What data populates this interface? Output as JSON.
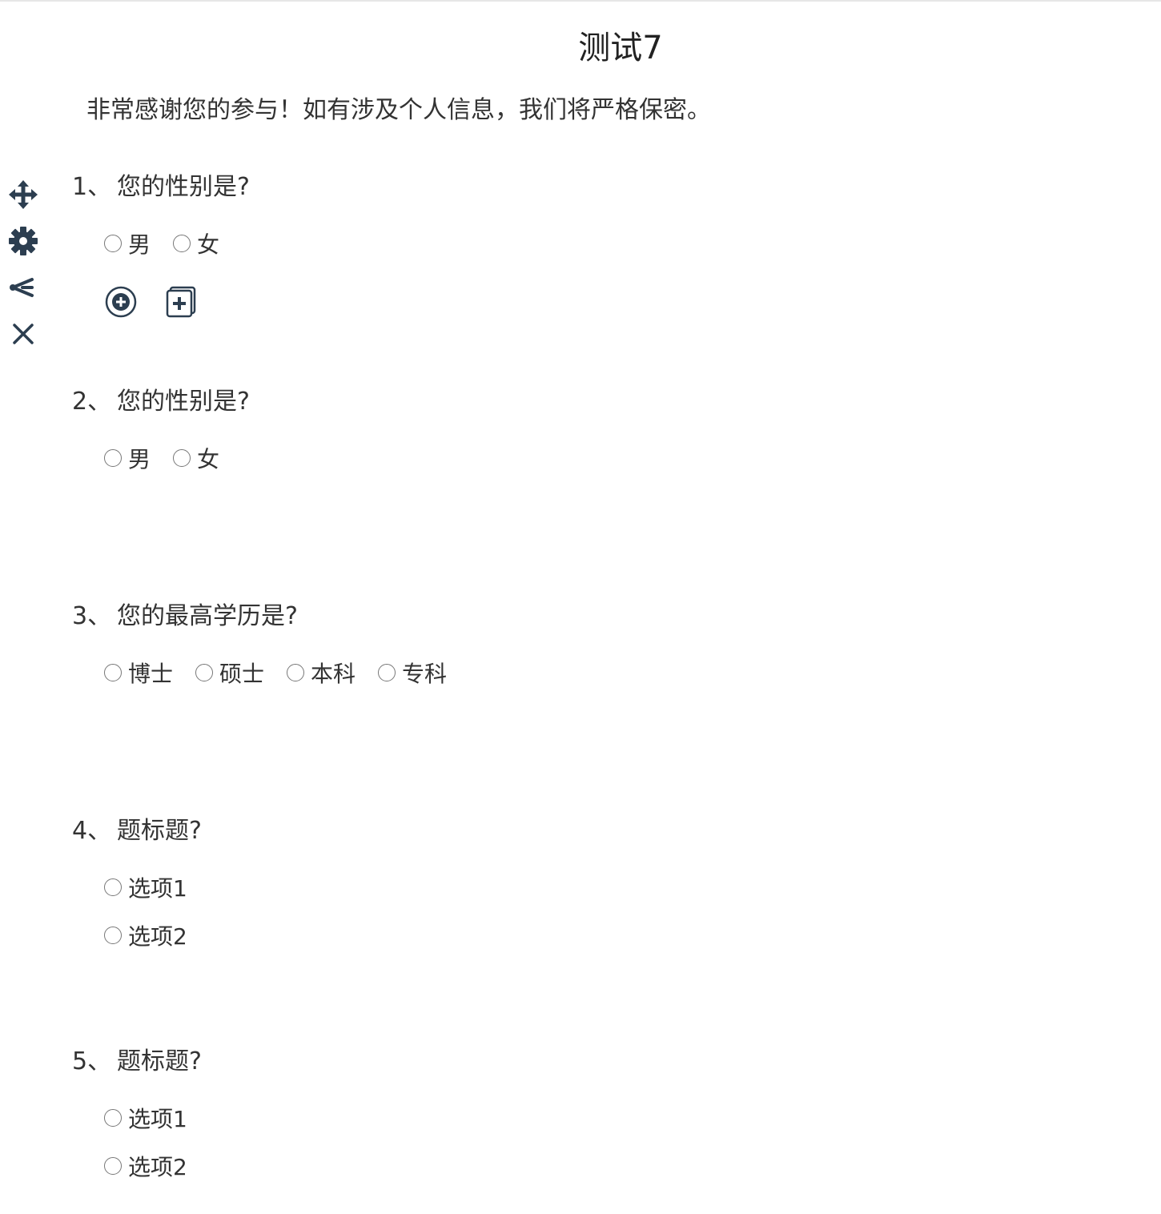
{
  "survey": {
    "title": "测试7",
    "intro": "非常感谢您的参与！如有涉及个人信息，我们将严格保密。"
  },
  "toolbar": {
    "icons": [
      "move-icon",
      "gear-icon",
      "logic-branch-icon",
      "close-icon"
    ],
    "color": "#2c3e50"
  },
  "questions": [
    {
      "number": "1、",
      "title": "您的性别是?",
      "options": [
        "男",
        "女"
      ]
    },
    {
      "number": "2、",
      "title": "您的性别是?",
      "options": [
        "男",
        "女"
      ]
    },
    {
      "number": "3、",
      "title": "您的最高学历是?",
      "options": [
        "博士",
        "硕士",
        "本科",
        "专科"
      ]
    },
    {
      "number": "4、",
      "title": "题标题?",
      "options": [
        "选项1",
        "选项2"
      ]
    },
    {
      "number": "5、",
      "title": "题标题?",
      "options": [
        "选项1",
        "选项2"
      ]
    }
  ]
}
